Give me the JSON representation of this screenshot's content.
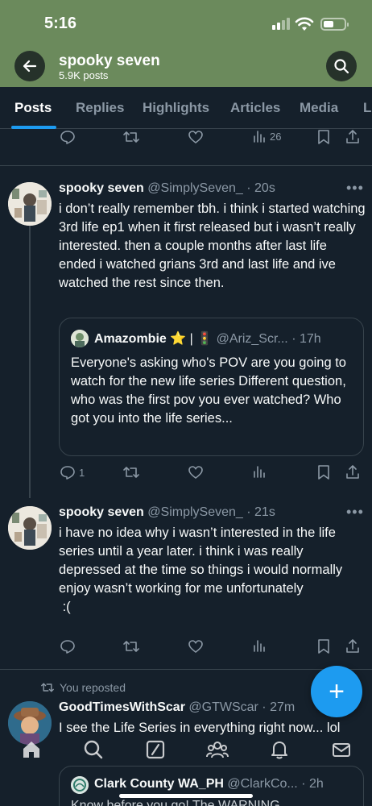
{
  "status_bar": {
    "time": "5:16"
  },
  "header": {
    "profile_name": "spooky seven",
    "post_count": "5.9K posts"
  },
  "tabs": [
    {
      "label": "Posts",
      "active": true
    },
    {
      "label": "Replies"
    },
    {
      "label": "Highlights"
    },
    {
      "label": "Articles"
    },
    {
      "label": "Media"
    },
    {
      "label": "L"
    }
  ],
  "top_actions": {
    "views": "26"
  },
  "tweets": [
    {
      "name": "spooky seven",
      "handle": "@SimplySeven_",
      "time": "20s",
      "text": "i don’t really remember tbh. i think i started watching 3rd life ep1 when it first released but i wasn’t really interested. then a couple months after last life ended i watched grians 3rd and last life and ive watched the rest since then.",
      "quote": {
        "name": "Amazombie",
        "emoji": "⭐ | 🚦",
        "handle": "@Ariz_Scr...",
        "time": "17h",
        "text": "Everyone's asking who's POV are you going to watch for the new life series Different question, who was the first pov you ever watched? Who got you into the life series..."
      },
      "actions": {
        "replies": "1",
        "reposts": "",
        "likes": "",
        "views": ""
      }
    },
    {
      "name": "spooky seven",
      "handle": "@SimplySeven_",
      "time": "21s",
      "text": "i have no idea why i wasn’t interested in the life series until a year later. i think i was really depressed at the time so things i would normally enjoy wasn’t working for me unfortunately\n :(",
      "actions": {
        "replies": "",
        "reposts": "",
        "likes": "",
        "views": ""
      }
    },
    {
      "repost_label": "You reposted",
      "name": "GoodTimesWithScar",
      "handle": "@GTWScar",
      "time": "27m",
      "text": "I see the Life Series in everything right now... lol",
      "quote": {
        "name": "Clark County WA_PH",
        "handle": "@ClarkCo...",
        "time": "2h",
        "text": "Know before you go! The WARNING"
      }
    }
  ],
  "fab": {
    "label": "+"
  },
  "colors": {
    "accent": "#1d9bf0",
    "header_bg": "#6b8a5c",
    "background": "#15202b"
  }
}
